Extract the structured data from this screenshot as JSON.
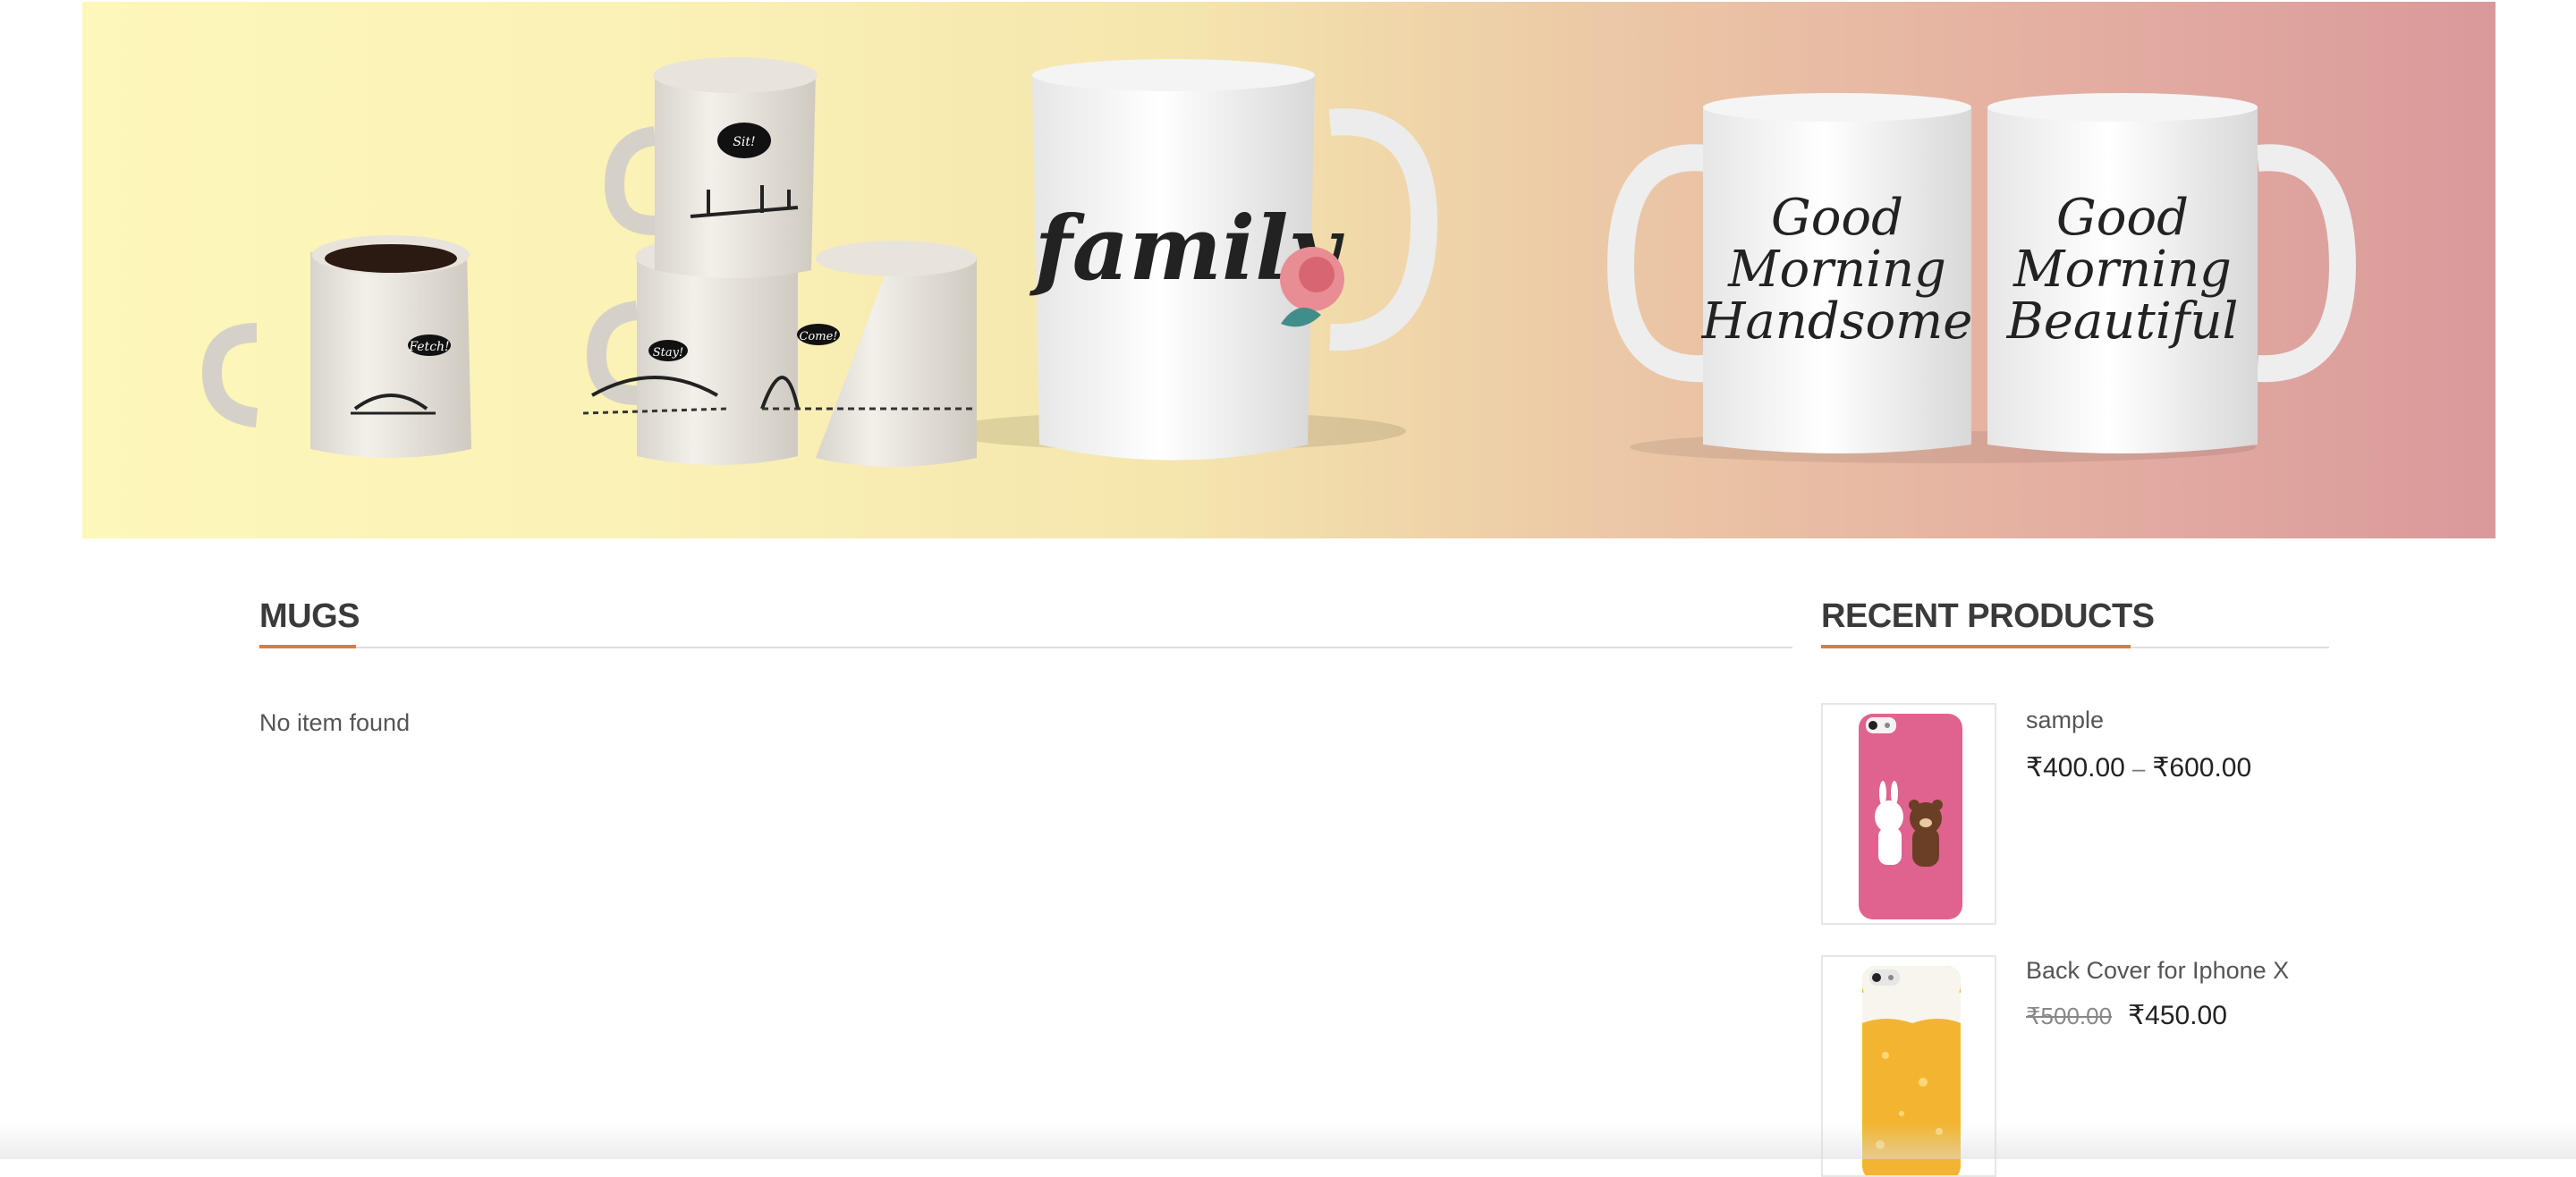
{
  "banner": {
    "mug_texts": [
      "family",
      "Good Morning Handsome",
      "Good Morning Beautiful"
    ],
    "bubble_texts": [
      "Fetch!",
      "Sit!",
      "Stay!",
      "Come!"
    ]
  },
  "main": {
    "title": "MUGS",
    "empty_message": "No item found"
  },
  "sidebar": {
    "title": "RECENT PRODUCTS",
    "products": [
      {
        "name": "sample",
        "price_from": "₹400.00",
        "separator": "–",
        "price_to": "₹600.00"
      },
      {
        "name": "Back Cover for Iphone X",
        "regular_price": "₹500.00",
        "sale_price": "₹450.00"
      }
    ]
  },
  "colors": {
    "accent": "#e07b39",
    "title": "#3a3a3a"
  }
}
